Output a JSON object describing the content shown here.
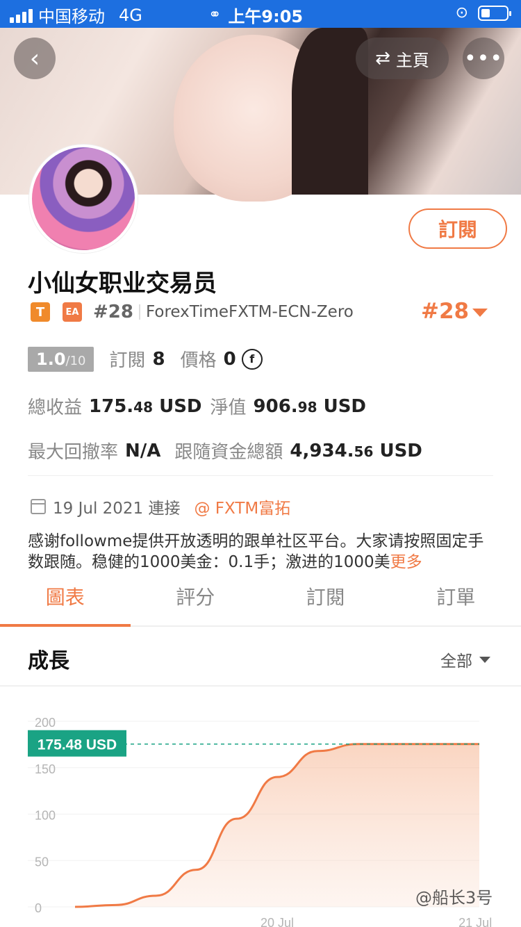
{
  "status_bar": {
    "carrier": "中国移动",
    "network": "4G",
    "time": "上午9:05"
  },
  "header": {
    "home_label": "主頁",
    "more_label": "•••",
    "back_label": "‹"
  },
  "profile": {
    "name": "小仙女职业交易员",
    "tag_t": "T",
    "tag_ea": "EA",
    "rank_small": "#28",
    "server": "ForexTimeFXTM-ECN-Zero",
    "rank_big": "#28",
    "subscribe_label": "訂閱",
    "score_main": "1.0",
    "score_sub": "/10",
    "subs_label": "訂閱",
    "subs_value": "8",
    "price_label": "價格",
    "price_value": "0",
    "price_coin": "f",
    "total_profit_label": "總收益",
    "total_profit_int": "175.",
    "total_profit_dec": "48",
    "total_profit_unit": "USD",
    "equity_label": "淨值",
    "equity_int": "906.",
    "equity_dec": "98",
    "equity_unit": "USD",
    "drawdown_label": "最大回撤率",
    "drawdown_value": "N/A",
    "follow_funds_label": "跟隨資金總額",
    "follow_funds_int": "4,934.",
    "follow_funds_dec": "56",
    "follow_funds_unit": "USD",
    "join_date": "19 Jul 2021 連接",
    "broker": "@ FXTM富拓",
    "description": "感谢followme提供开放透明的跟单社区平台。大家请按照固定手数跟随。稳健的1000美金：0.1手；激进的1000美",
    "more_label": "更多"
  },
  "tabs": [
    {
      "label": "圖表",
      "active": true
    },
    {
      "label": "評分",
      "active": false
    },
    {
      "label": "訂閱",
      "active": false
    },
    {
      "label": "訂單",
      "active": false
    }
  ],
  "section": {
    "title": "成長",
    "filter": "全部"
  },
  "colors": {
    "accent": "#f07a45",
    "status_blue": "#1d6fe0",
    "label_green": "#1aa384"
  },
  "watermark": "@船长3号",
  "chart_data": {
    "type": "area",
    "x_tick_labels": [
      "20 Jul",
      "21 Jul"
    ],
    "yticks": [
      0,
      50,
      100,
      150,
      200
    ],
    "ylim": [
      0,
      200
    ],
    "current_value_label": "175.48 USD",
    "current_value": 175.48,
    "series": [
      {
        "x": [
          0,
          0.1,
          0.2,
          0.3,
          0.4,
          0.5,
          0.6,
          0.7,
          0.8,
          0.9,
          1.0
        ],
        "y": [
          0,
          2,
          12,
          40,
          95,
          140,
          168,
          175.48,
          175.48,
          175.48,
          175.48
        ]
      }
    ],
    "grid": true
  }
}
